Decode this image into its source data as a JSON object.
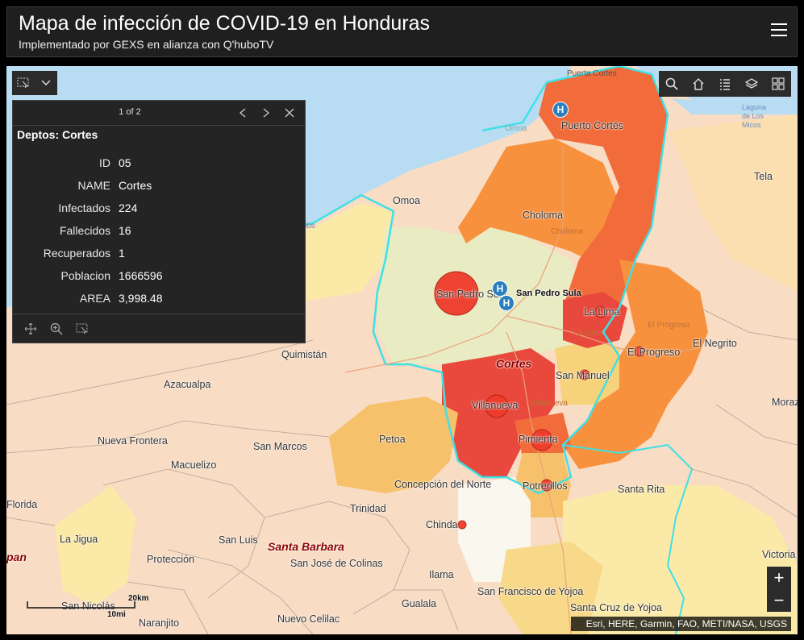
{
  "header": {
    "title": "Mapa de infección de COVID-19 en Honduras",
    "subtitle": "Implementado por GEXS en alianza con Q'huboTV"
  },
  "popup": {
    "pager": "1 of 2",
    "title": "Deptos: Cortes",
    "fields": [
      {
        "key": "ID",
        "value": "05"
      },
      {
        "key": "NAME",
        "value": "Cortes"
      },
      {
        "key": "Infectados",
        "value": "224"
      },
      {
        "key": "Fallecidos",
        "value": "16"
      },
      {
        "key": "Recuperados",
        "value": "1"
      },
      {
        "key": "Poblacion",
        "value": "1666596"
      },
      {
        "key": "AREA",
        "value": "3,998.48"
      }
    ]
  },
  "map_labels": {
    "puerto_cortes_top": "Puerta Cortes",
    "puerto_cortes": "Puerto Cortés",
    "omoa_water": "Omoa",
    "laguna": "Laguna de Los Micos",
    "tela": "Tela",
    "omoa": "Omoa",
    "choloma": "Choloma",
    "choloma_faint": "Choloma",
    "los": "los",
    "san_pedro_sula": "San Pedro Sula",
    "san_pedro_sula_bold": "San Pedro Sula",
    "la_lima": "La Lima",
    "la_lima_faint": "La Lima",
    "el_progreso_faint": "El Progreso",
    "el_progreso": "El Progreso",
    "el_negrito": "El Negrito",
    "quimistan": "Quimistán",
    "cortes": "Cortes",
    "san_manuel": "San Manuel",
    "azacualpa": "Azacualpa",
    "villanueva": "Villanueva",
    "villanueva_faint": "Villanueva",
    "moraz": "Moraz",
    "nueva_frontera": "Nueva Frontera",
    "san_marcos": "San Marcos",
    "petoa": "Petoa",
    "pimienta": "Pimienta",
    "macuelizo": "Macuelizo",
    "concepcion": "Concepción del Norte",
    "potrerillos": "Potrerillos",
    "santa_rita": "Santa Rita",
    "florida": "Florida",
    "trinidad": "Trinidad",
    "chinda": "Chinda",
    "la_jigua": "La Jigua",
    "san_luis": "San Luis",
    "santa_barbara": "Santa Barbara",
    "pan": "pan",
    "proteccion": "Protección",
    "san_jose": "San José de Colinas",
    "victoria": "Victoria",
    "ilama": "Ilama",
    "san_francisco": "San Francisco de Yojoa",
    "san_nicolas": "San Nicolás",
    "gualala": "Gualala",
    "santa_cruz": "Santa Cruz de Yojoa",
    "naranjito": "Naranjito",
    "nuevo_celilac": "Nuevo Celilac"
  },
  "hospital_icon_label": "H",
  "scale": {
    "km": "20km",
    "mi": "10mi"
  },
  "zoom": {
    "in": "+",
    "out": "−"
  },
  "attribution": "Esri, HERE, Garmin, FAO, METI/NASA, USGS",
  "colors": {
    "header_bg": "#1f1f1f",
    "water": "#b8dcf2",
    "land": "#f8dcc4",
    "cortes_border": "#3fe0e6",
    "high": "#e8493c",
    "medium_high": "#f26b3a",
    "medium": "#f7913d",
    "low": "#f6c16a",
    "very_low": "#fbe9a8",
    "case_circle": "#ef3b2c"
  },
  "icons": [
    "select-icon",
    "dropdown-icon",
    "search-icon",
    "home-icon",
    "legend-icon",
    "layers-icon",
    "basemap-icon",
    "prev-icon",
    "next-icon",
    "close-icon",
    "pan-icon",
    "zoom-to-icon",
    "select-feature-icon",
    "hospital-icon",
    "menu-icon"
  ]
}
